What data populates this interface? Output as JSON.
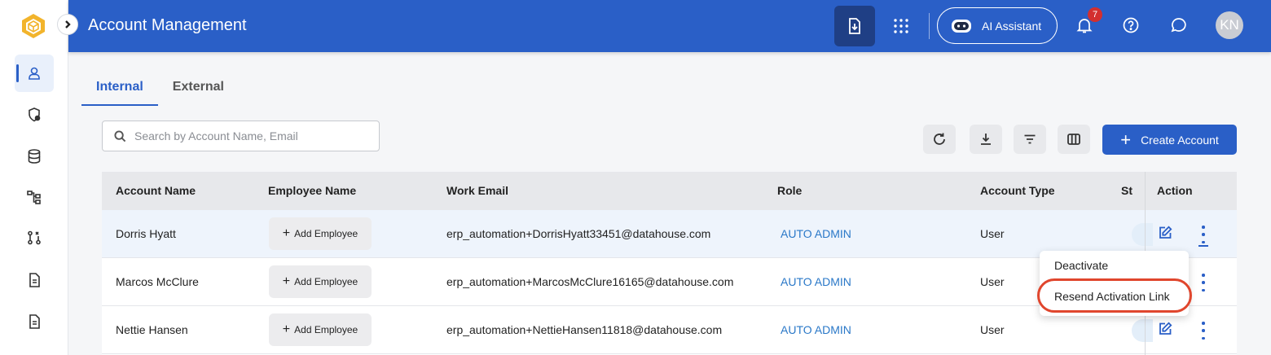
{
  "app": {
    "title": "Account Management",
    "ai_assistant_label": "AI Assistant",
    "notification_count": "7",
    "user_initials": "KN"
  },
  "colors": {
    "primary": "#2a5fc7",
    "header_dark": "#1f3f85",
    "badge": "#d32f2f",
    "highlight": "#e0462d"
  },
  "rail": {
    "items": [
      {
        "icon": "user-icon",
        "active": true
      },
      {
        "icon": "security-icon",
        "active": false
      },
      {
        "icon": "database-icon",
        "active": false
      },
      {
        "icon": "hierarchy-icon",
        "active": false
      },
      {
        "icon": "workflow-icon",
        "active": false
      },
      {
        "icon": "document-icon",
        "active": false
      },
      {
        "icon": "report-icon",
        "active": false
      }
    ]
  },
  "tabs": [
    {
      "label": "Internal",
      "active": true
    },
    {
      "label": "External",
      "active": false
    }
  ],
  "search": {
    "placeholder": "Search by Account Name, Email",
    "value": ""
  },
  "toolbar": {
    "create_label": "Create Account"
  },
  "table": {
    "headers": {
      "account_name": "Account Name",
      "employee_name": "Employee Name",
      "work_email": "Work Email",
      "role": "Role",
      "account_type": "Account Type",
      "status": "St",
      "action": "Action"
    },
    "add_employee_label": "Add Employee",
    "rows": [
      {
        "account_name": "Dorris Hyatt",
        "email": "erp_automation+DorrisHyatt33451@datahouse.com",
        "role": "AUTO ADMIN",
        "account_type": "User"
      },
      {
        "account_name": "Marcos McClure",
        "email": "erp_automation+MarcosMcClure16165@datahouse.com",
        "role": "AUTO ADMIN",
        "account_type": "User"
      },
      {
        "account_name": "Nettie Hansen",
        "email": "erp_automation+NettieHansen11818@datahouse.com",
        "role": "AUTO ADMIN",
        "account_type": "User"
      }
    ]
  },
  "menu": {
    "deactivate": "Deactivate",
    "resend": "Resend Activation Link"
  }
}
